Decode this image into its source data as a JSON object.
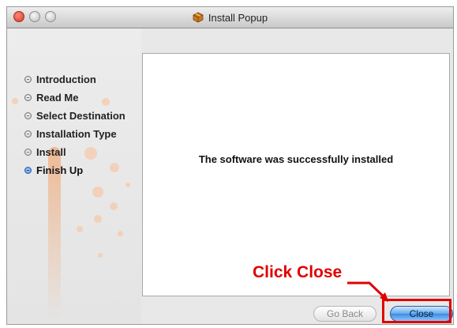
{
  "window": {
    "title": "Install Popup",
    "icon": "package-icon"
  },
  "sidebar": {
    "steps": [
      {
        "label": "Introduction",
        "current": false
      },
      {
        "label": "Read Me",
        "current": false
      },
      {
        "label": "Select Destination",
        "current": false
      },
      {
        "label": "Installation Type",
        "current": false
      },
      {
        "label": "Install",
        "current": false
      },
      {
        "label": "Finish Up",
        "current": true
      }
    ]
  },
  "content": {
    "message": "The software was successfully installed"
  },
  "buttons": {
    "go_back": "Go Back",
    "close": "Close"
  },
  "annotation": {
    "text": "Click Close",
    "color": "#e00000"
  },
  "colors": {
    "accent_blue": "#3f8be0",
    "window_bg": "#e8e8e8"
  }
}
